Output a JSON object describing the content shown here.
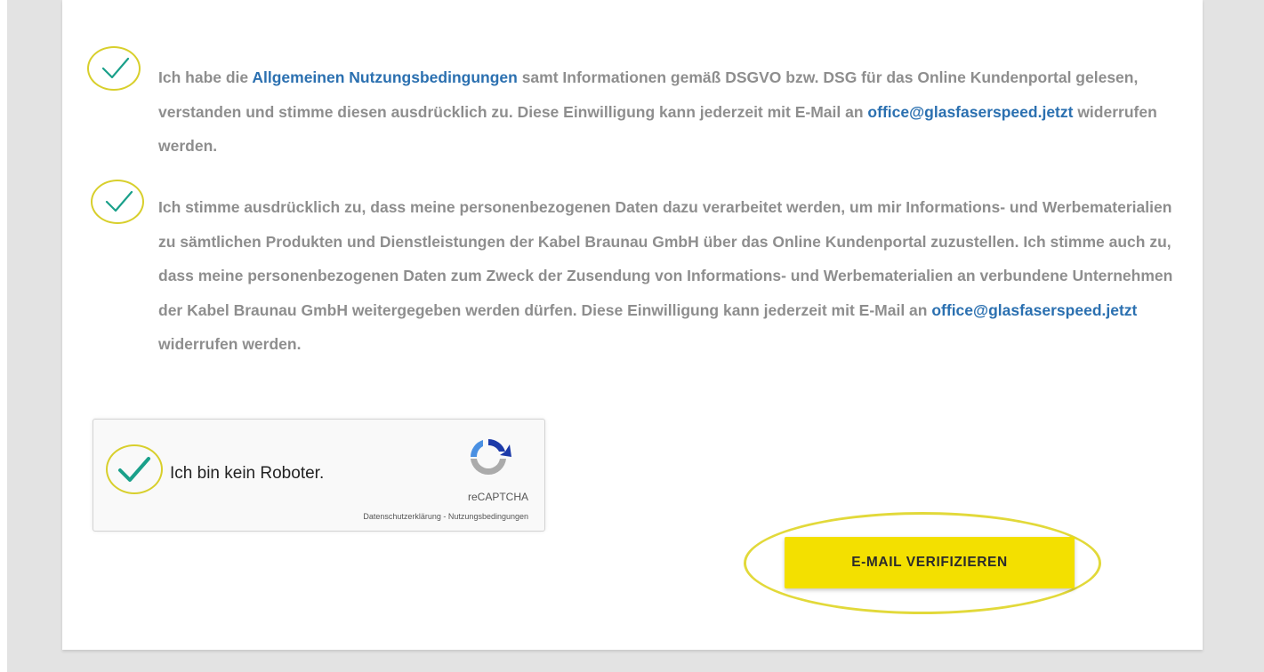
{
  "consents": [
    {
      "text_before": "Ich habe die ",
      "link1": "Allgemeinen Nutzungsbedingungen",
      "text_middle": " samt Informationen gemäß DSGVO bzw. DSG für das Online Kundenportal gelesen, verstanden und stimme diesen ausdrücklich zu. Diese Einwilligung kann jederzeit mit E-Mail an ",
      "link2": "office@glasfaserspeed.jetzt",
      "text_after": " widerrufen werden.",
      "checked": true
    },
    {
      "text_before": "Ich stimme ausdrücklich zu, dass meine personenbezogenen Daten dazu verarbeitet werden, um mir Informations- und Werbematerialien zu sämtlichen Produkten und Dienstleistungen der Kabel Braunau GmbH über das Online Kundenportal zuzustellen. Ich stimme auch zu, dass meine personenbezogenen Daten zum Zweck der Zusendung von Informations- und Werbematerialien an verbundene Unternehmen der Kabel Braunau GmbH weitergegeben werden dürfen. Diese Einwilligung kann jederzeit mit E-Mail an ",
      "link": "office@glasfaserspeed.jetzt",
      "text_after": " widerrufen werden.",
      "checked": true
    }
  ],
  "captcha": {
    "label": "Ich bin kein Roboter.",
    "brand": "reCAPTCHA",
    "privacy_link": "Datenschutzerklärung",
    "separator": " - ",
    "terms_link": "Nutzungsbedingungen",
    "checked": true
  },
  "verify_button": {
    "label": "E-MAIL VERIFIZIEREN"
  },
  "colors": {
    "link": "#2b70b0",
    "text": "#8e8e8e",
    "highlight_ring": "#d8cf2c",
    "check": "#1aa08a",
    "button": "#f3e000"
  },
  "icons": [
    "checkmark-icon",
    "recaptcha-logo-icon"
  ]
}
